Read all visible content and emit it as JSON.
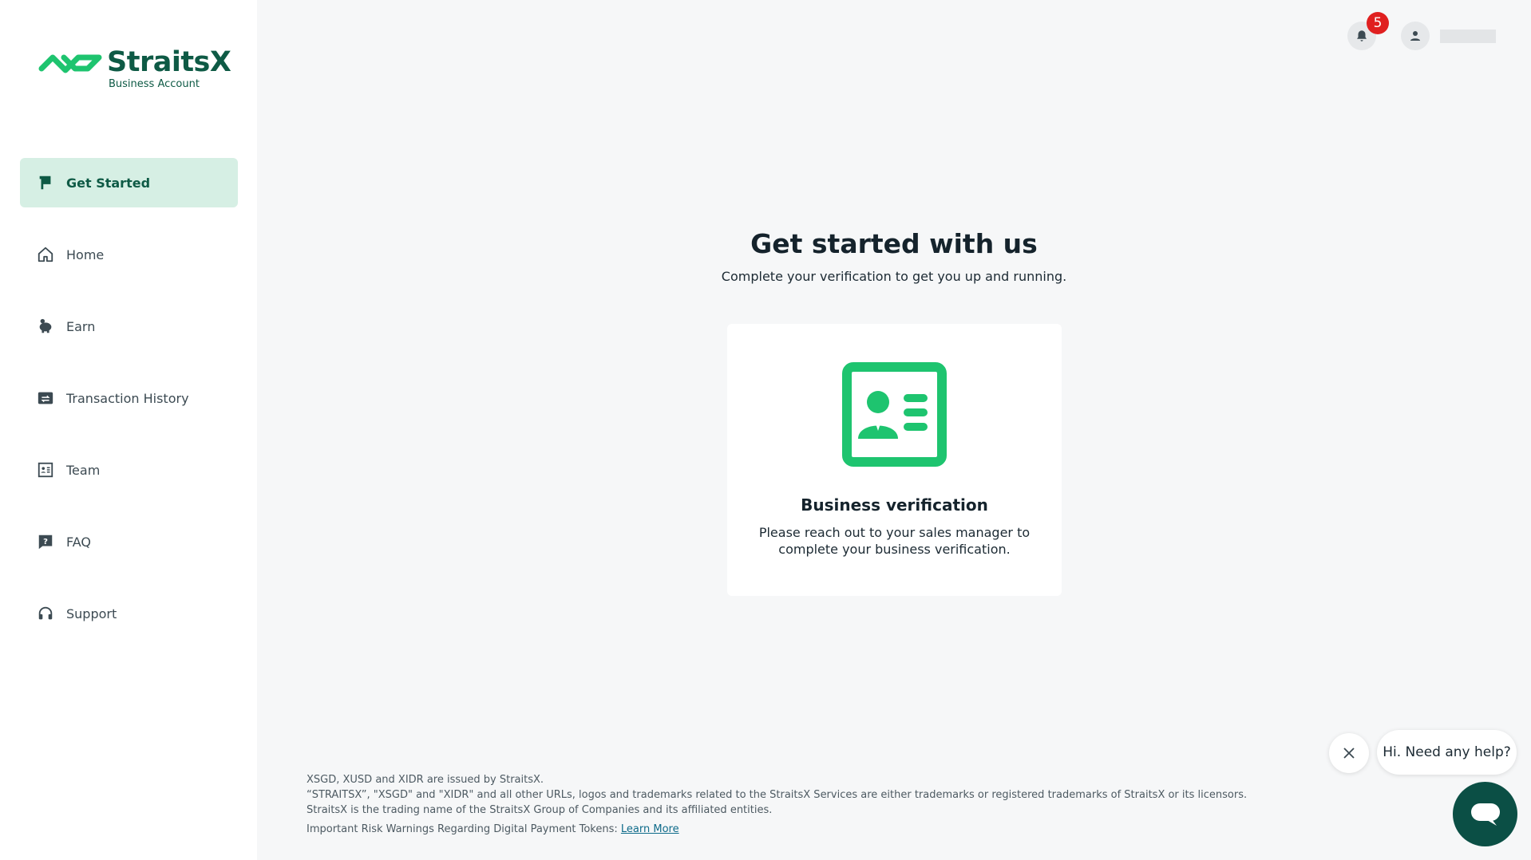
{
  "brand": {
    "name": "StraitsX",
    "subtitle": "Business Account",
    "colors": {
      "primary": "#0e5a45",
      "accent": "#1ec46f",
      "active_bg": "#d6efe4"
    }
  },
  "sidebar": {
    "items": [
      {
        "label": "Get Started",
        "icon": "flag-icon",
        "active": true
      },
      {
        "label": "Home",
        "icon": "home-icon"
      },
      {
        "label": "Earn",
        "icon": "piggy-bank-icon"
      },
      {
        "label": "Transaction History",
        "icon": "transaction-history-icon"
      },
      {
        "label": "Team",
        "icon": "id-card-icon"
      },
      {
        "label": "FAQ",
        "icon": "question-icon"
      },
      {
        "label": "Support",
        "icon": "headset-icon"
      }
    ]
  },
  "topbar": {
    "notifications_count": "5",
    "bell_icon": "bell-icon",
    "avatar_icon": "user-icon"
  },
  "main": {
    "title": "Get started with us",
    "subtitle": "Complete your verification to get you up and running.",
    "card": {
      "icon": "id-card-icon",
      "title": "Business verification",
      "description": "Please reach out to your sales manager to complete your business verification."
    }
  },
  "footer": {
    "line1": "XSGD, XUSD and XIDR are issued by StraitsX.",
    "line2": "“STRAITSX”, \"XSGD\" and \"XIDR\" and all other URLs, logos and trademarks related to the StraitsX Services are either trademarks or registered trademarks of StraitsX or its licensors.",
    "line3": "StraitsX is the trading name of the StraitsX Group of Companies and its affiliated entities.",
    "risk_text": "Important Risk Warnings Regarding Digital Payment Tokens: ",
    "risk_link": "Learn More"
  },
  "chat": {
    "greeting": "Hi. Need any help?"
  }
}
